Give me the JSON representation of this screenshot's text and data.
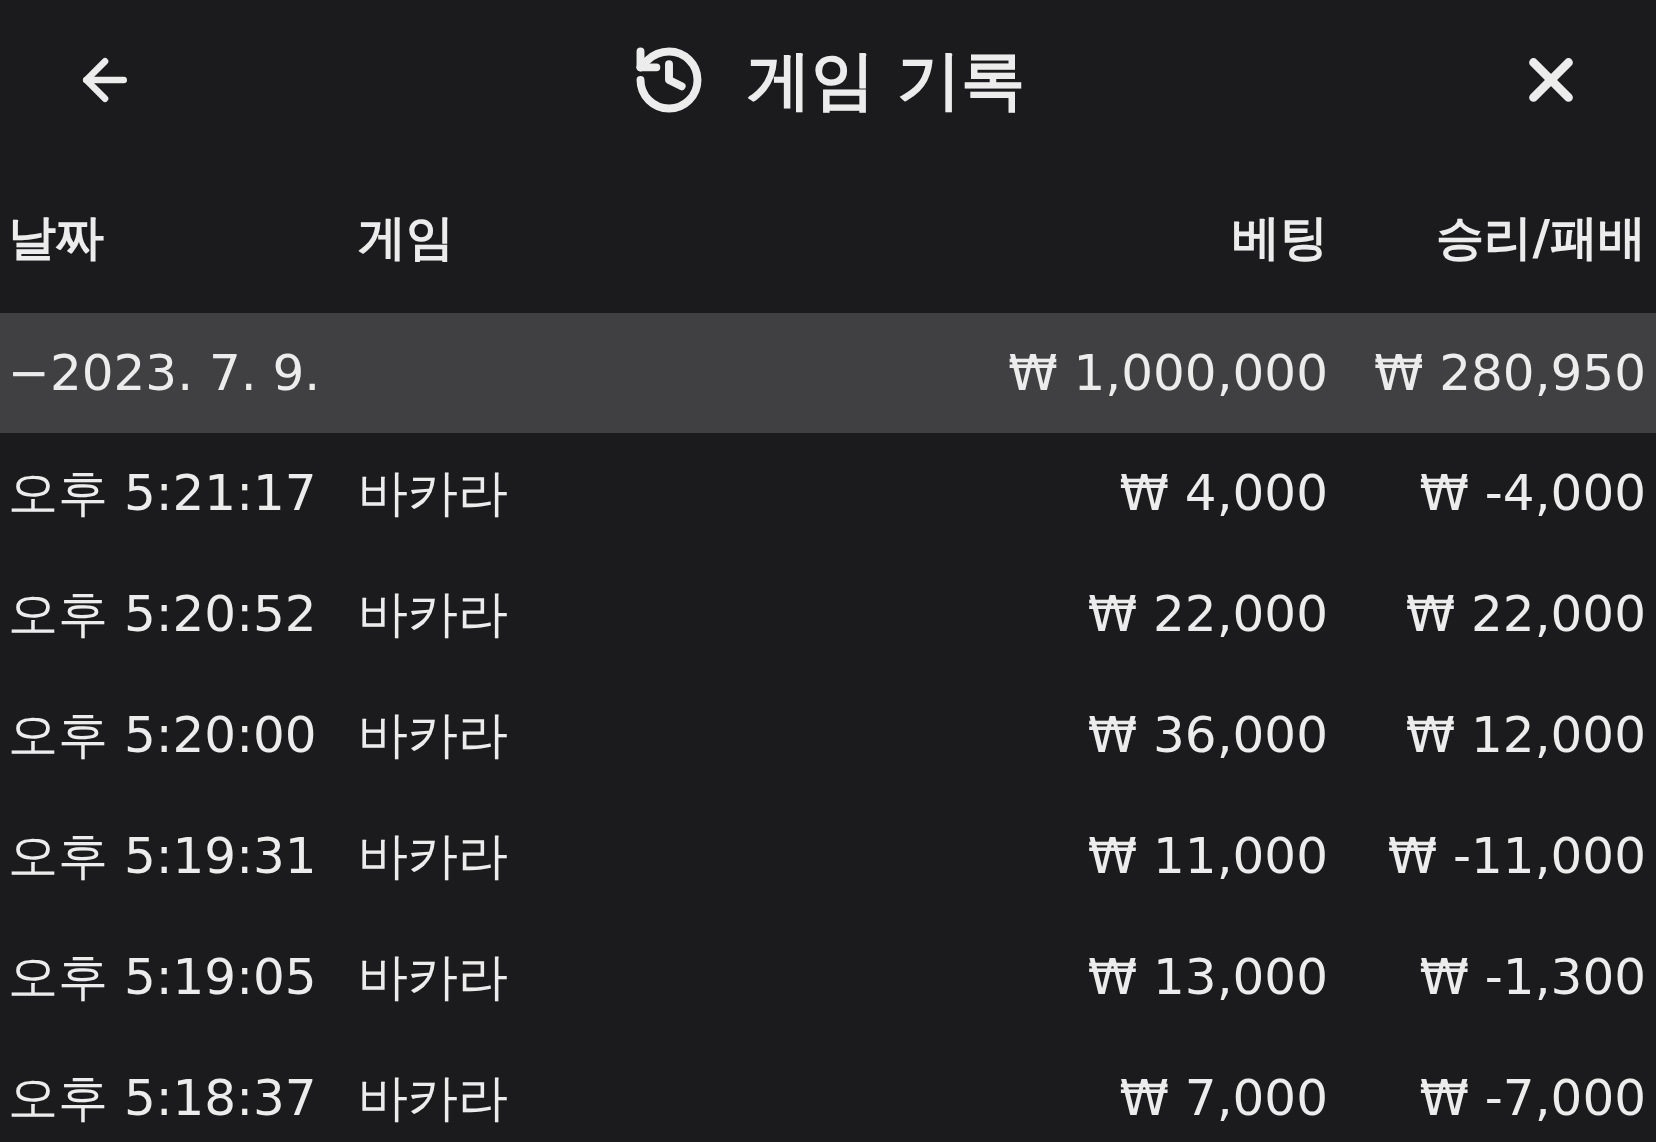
{
  "header": {
    "title": "게임 기록"
  },
  "columns": [
    "날짜",
    "게임",
    "베팅",
    "승리/패배"
  ],
  "summary": {
    "date": "−2023. 7. 9.",
    "bet": "₩ 1,000,000",
    "result": "₩ 280,950"
  },
  "rows": [
    {
      "time": "오후 5:21:17",
      "game": "바카라",
      "bet": "₩ 4,000",
      "result": "₩ -4,000"
    },
    {
      "time": "오후 5:20:52",
      "game": "바카라",
      "bet": "₩ 22,000",
      "result": "₩ 22,000"
    },
    {
      "time": "오후 5:20:00",
      "game": "바카라",
      "bet": "₩ 36,000",
      "result": "₩ 12,000"
    },
    {
      "time": "오후 5:19:31",
      "game": "바카라",
      "bet": "₩ 11,000",
      "result": "₩ -11,000"
    },
    {
      "time": "오후 5:19:05",
      "game": "바카라",
      "bet": "₩ 13,000",
      "result": "₩ -1,300"
    },
    {
      "time": "오후 5:18:37",
      "game": "바카라",
      "bet": "₩ 7,000",
      "result": "₩ -7,000"
    }
  ]
}
